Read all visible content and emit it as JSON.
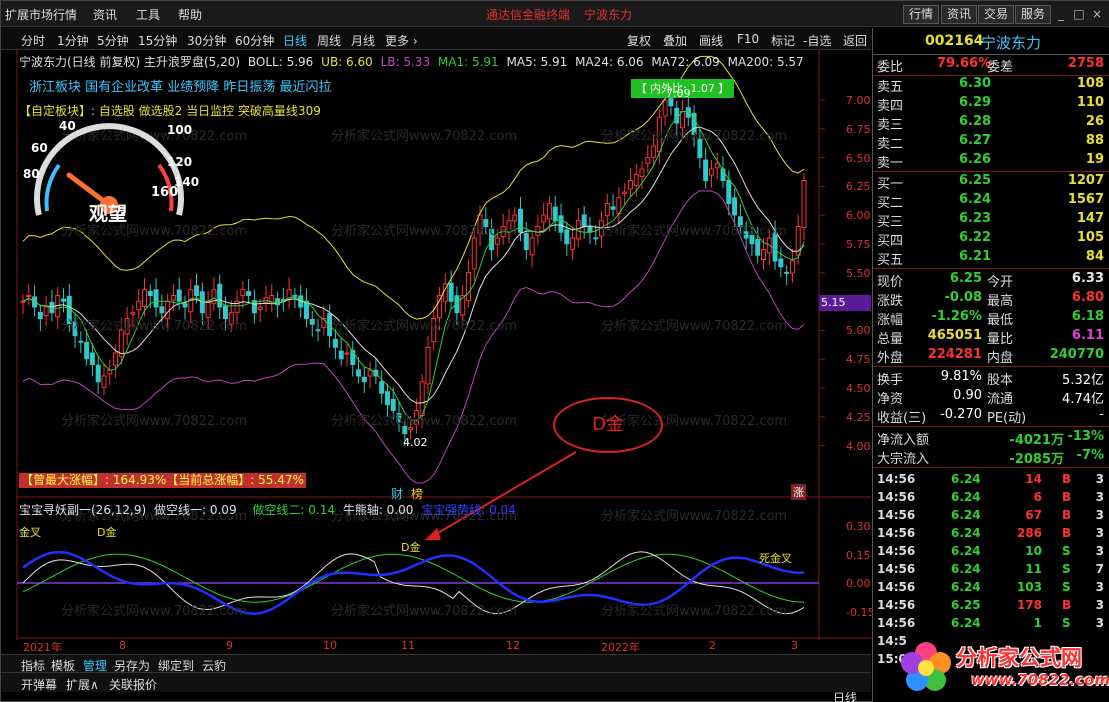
{
  "menubar": {
    "menus": [
      "扩展市场行情",
      "资讯",
      "工具",
      "帮助"
    ],
    "center_left": "通达信金融终端",
    "center_right": "宁波东力",
    "buttons": [
      "行情",
      "资讯",
      "交易",
      "服务"
    ],
    "window_controls": [
      "_",
      "□",
      "×"
    ]
  },
  "periods": {
    "items": [
      "分时",
      "1分钟",
      "5分钟",
      "15分钟",
      "30分钟",
      "60分钟",
      "日线",
      "周线",
      "月线",
      "更多 ›"
    ],
    "active": "日线",
    "right_items": [
      "复权",
      "叠加",
      "画线",
      "F10",
      "标记",
      "-自选",
      "返回"
    ]
  },
  "overlay": {
    "line1": {
      "name": "宁波东力(日线 前复权) 主升浪罗盘(5,20)",
      "boll": "BOLL: 5.96",
      "ub": "UB: 6.60",
      "lb": "LB: 5.33",
      "ma1": "MA1: 5.91",
      "ma5": "MA5: 5.91",
      "ma24": "MA24: 6.06",
      "ma72": "MA72: 6.09",
      "ma200": "MA200: 5.57"
    },
    "line2": "浙江板块  国有企业改革  业绩预降  昨日振荡  最近闪拉",
    "line3": "【自定板块】: 自选股 做选股2 当日监控 突破高量线309",
    "gauge_label": "观望",
    "gauge_ticks": [
      "40",
      "60",
      "80",
      "100",
      "120",
      "140",
      "160"
    ],
    "hl_label": "【 内外比: 1.07 】",
    "high_mark": "7.09",
    "low_mark": "4.02",
    "stat_max": "【曾最大涨幅】: 164.93%【当前总涨幅】: 55.47%",
    "badge_cai": "财",
    "badge_bang": "榜",
    "badge_zhang": "涨",
    "price_tag": "5.15",
    "watermark": "分析家公式网www.70822.com"
  },
  "price_axis": [
    "7.00",
    "6.75",
    "6.50",
    "6.25",
    "6.00",
    "5.75",
    "5.50",
    "5.25",
    "5.00",
    "4.75",
    "4.50",
    "4.25",
    "4.00"
  ],
  "indicator": {
    "title": "宝宝寻妖副一(26,12,9)",
    "s1": "做空线一: 0.09",
    "s2": "做空线二: 0.14",
    "s3": "牛熊轴: 0.00",
    "s4": "宝宝强势线: 0.04",
    "axis": [
      "0.30",
      "0.15",
      "0.00",
      "-0.15"
    ],
    "labels": [
      "金叉",
      "D金",
      "D金",
      "死金叉"
    ],
    "callout": "D金"
  },
  "xaxis": [
    "2021年",
    "8",
    "9",
    "10",
    "11",
    "12",
    "2022年",
    "2",
    "3"
  ],
  "tabs": [
    "指标",
    "模板",
    "管理",
    "另存为",
    "绑定到",
    "云豹"
  ],
  "tabs_active": "管理",
  "status": [
    "开弹幕",
    "扩展∧",
    "关联报价"
  ],
  "right_bottom": {
    "period": "日线",
    "plus": "+",
    "minus": "-"
  },
  "quote": {
    "code": "002164",
    "name": "宁波东力",
    "weibi_label": "委比",
    "weibi": "79.66%",
    "weicha_label": "委差",
    "weicha": "2758",
    "sell": [
      {
        "label": "卖五",
        "price": "6.30",
        "vol": "108"
      },
      {
        "label": "卖四",
        "price": "6.29",
        "vol": "110"
      },
      {
        "label": "卖三",
        "price": "6.28",
        "vol": "26"
      },
      {
        "label": "卖二",
        "price": "6.27",
        "vol": "88"
      },
      {
        "label": "卖一",
        "price": "6.26",
        "vol": "19"
      }
    ],
    "buy": [
      {
        "label": "买一",
        "price": "6.25",
        "vol": "1207"
      },
      {
        "label": "买二",
        "price": "6.24",
        "vol": "1567"
      },
      {
        "label": "买三",
        "price": "6.23",
        "vol": "147"
      },
      {
        "label": "买四",
        "price": "6.22",
        "vol": "105"
      },
      {
        "label": "买五",
        "price": "6.21",
        "vol": "84"
      }
    ],
    "stats": [
      {
        "l1": "现价",
        "v1": "6.25",
        "c1": "#30d030",
        "l2": "今开",
        "v2": "6.33",
        "c2": "#e8e8e8"
      },
      {
        "l1": "涨跌",
        "v1": "-0.08",
        "c1": "#30d030",
        "l2": "最高",
        "v2": "6.80",
        "c2": "#ff3030"
      },
      {
        "l1": "涨幅",
        "v1": "-1.26%",
        "c1": "#30d030",
        "l2": "最低",
        "v2": "6.18",
        "c2": "#30d030"
      },
      {
        "l1": "总量",
        "v1": "465051",
        "c1": "#e8e030",
        "l2": "量比",
        "v2": "6.11",
        "c2": "#e040e0"
      },
      {
        "l1": "外盘",
        "v1": "224281",
        "c1": "#ff3030",
        "l2": "内盘",
        "v2": "240770",
        "c2": "#30d030"
      }
    ],
    "stats2": [
      {
        "l1": "换手",
        "v1": "9.81%",
        "l2": "股本",
        "v2": "5.32亿"
      },
      {
        "l1": "净资",
        "v1": "0.90",
        "l2": "流通",
        "v2": "4.74亿"
      },
      {
        "l1": "收益(三)",
        "v1": "-0.270",
        "l2": "PE(动)",
        "v2": "-"
      }
    ],
    "flow": [
      {
        "label": "净流入额",
        "value": "-4021万",
        "pct": "-13%"
      },
      {
        "label": "大宗流入",
        "value": "-2085万",
        "pct": "-7%"
      }
    ],
    "ticks": [
      {
        "t": "14:56",
        "p": "6.24",
        "v": "14",
        "s": "B",
        "n": "3"
      },
      {
        "t": "14:56",
        "p": "6.24",
        "v": "6",
        "s": "B",
        "n": "3"
      },
      {
        "t": "14:56",
        "p": "6.24",
        "v": "67",
        "s": "B",
        "n": "3"
      },
      {
        "t": "14:56",
        "p": "6.24",
        "v": "286",
        "s": "B",
        "n": "3"
      },
      {
        "t": "14:56",
        "p": "6.24",
        "v": "10",
        "s": "S",
        "n": "3"
      },
      {
        "t": "14:56",
        "p": "6.24",
        "v": "11",
        "s": "S",
        "n": "7"
      },
      {
        "t": "14:56",
        "p": "6.24",
        "v": "103",
        "s": "S",
        "n": "3"
      },
      {
        "t": "14:56",
        "p": "6.25",
        "v": "178",
        "s": "B",
        "n": "3"
      },
      {
        "t": "14:56",
        "p": "6.24",
        "v": "1",
        "s": "S",
        "n": "3"
      },
      {
        "t": "14:5",
        "p": "",
        "v": "",
        "s": "",
        "n": ""
      },
      {
        "t": "15:0",
        "p": "",
        "v": "",
        "s": "",
        "n": ""
      }
    ]
  },
  "logo": {
    "line1": "分析家公式网",
    "line2": "www.70822.com"
  },
  "colors": {
    "up": "#ff3030",
    "down": "#30c8c8",
    "accent": "#3cc8ff",
    "yellow": "#e8e030",
    "magenta": "#c040c0"
  }
}
